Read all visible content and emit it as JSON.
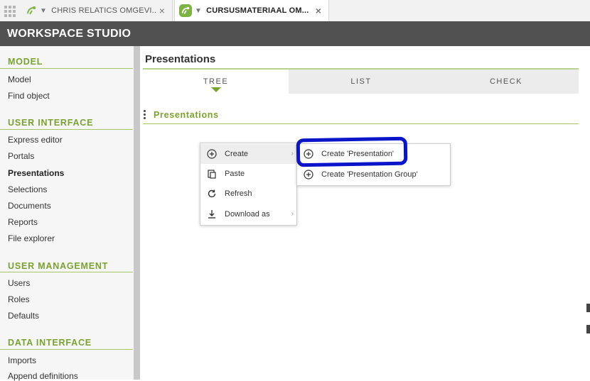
{
  "tabs": [
    {
      "label": "CHRIS RELATICS OMGEVI...",
      "logo": "relatics-logo-icon",
      "close": "×"
    },
    {
      "label": "CURSUSMATERIAAL OM...",
      "logo": "relatics-logo-icon",
      "close": "×"
    }
  ],
  "header": {
    "title": "WORKSPACE STUDIO"
  },
  "sidebar": {
    "sections": [
      {
        "title": "MODEL",
        "items": [
          "Model",
          "Find object"
        ]
      },
      {
        "title": "USER INTERFACE",
        "items": [
          "Express editor",
          "Portals",
          "Presentations",
          "Selections",
          "Documents",
          "Reports",
          "File explorer"
        ],
        "active": "Presentations"
      },
      {
        "title": "USER MANAGEMENT",
        "items": [
          "Users",
          "Roles",
          "Defaults"
        ]
      },
      {
        "title": "DATA INTERFACE",
        "items": [
          "Imports",
          "Append definitions"
        ]
      }
    ]
  },
  "main": {
    "title": "Presentations",
    "view_tabs": [
      "TREE",
      "LIST",
      "CHECK"
    ],
    "active_view": "TREE",
    "section_heading": "Presentations"
  },
  "context_menu": {
    "items": [
      {
        "label": "Create",
        "icon": "plus-circle-icon",
        "submenu": true
      },
      {
        "label": "Paste",
        "icon": "paste-icon",
        "submenu": false
      },
      {
        "label": "Refresh",
        "icon": "refresh-icon",
        "submenu": false
      },
      {
        "label": "Download as",
        "icon": "download-icon",
        "submenu": true
      }
    ]
  },
  "submenu": {
    "items": [
      {
        "label": "Create 'Presentation'",
        "icon": "plus-circle-icon"
      },
      {
        "label": "Create 'Presentation Group'",
        "icon": "plus-circle-icon"
      }
    ]
  },
  "colors": {
    "accent": "#7aa22f",
    "header_bg": "#515151",
    "annotation": "#0a14c8"
  }
}
